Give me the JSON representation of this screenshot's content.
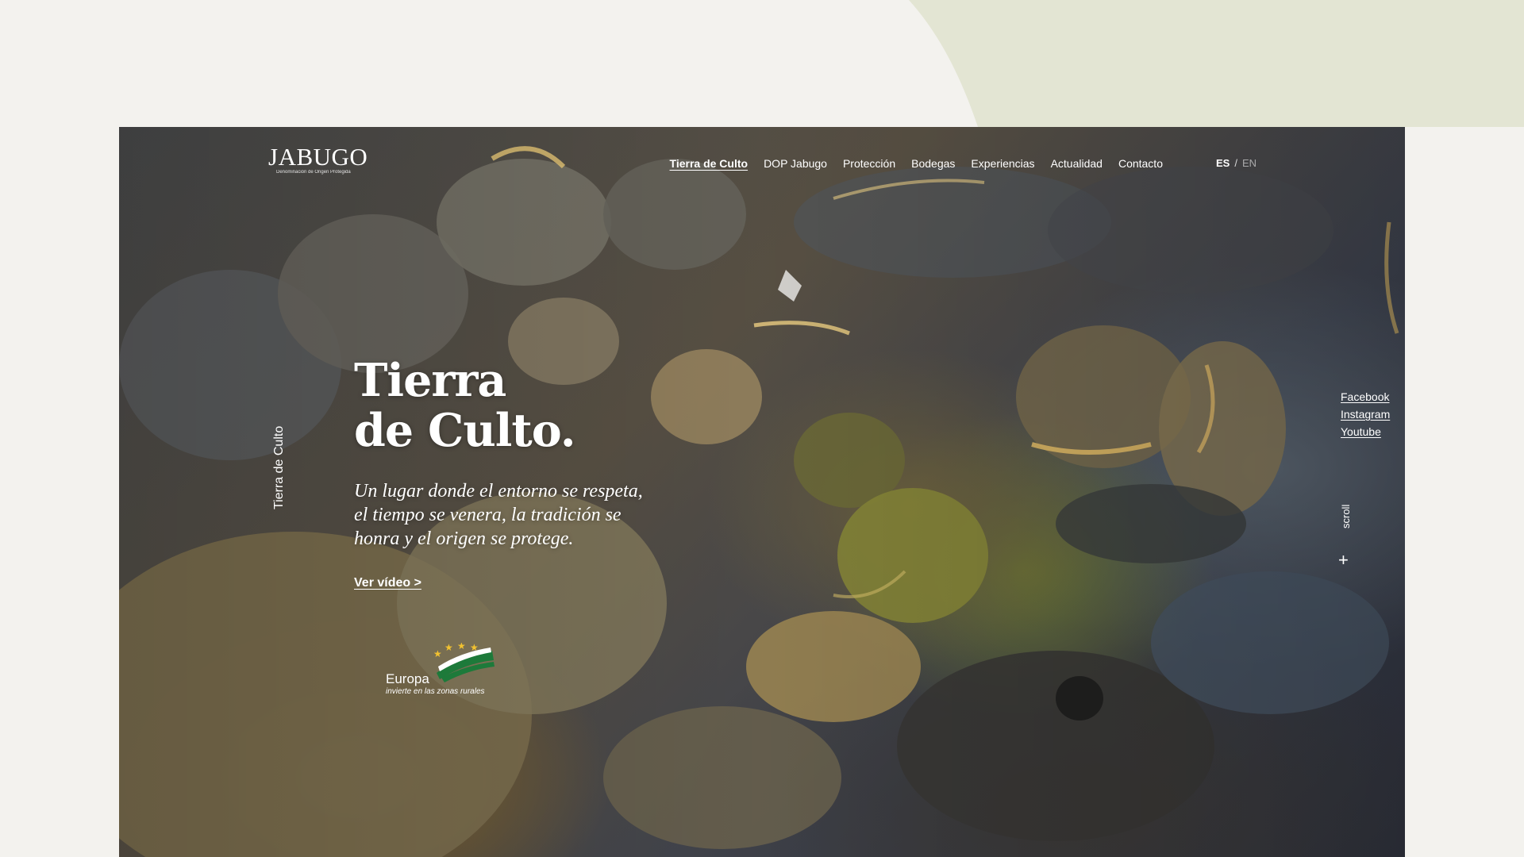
{
  "brand": {
    "name": "JABUGO",
    "subtitle": "Denominación de Origen Protegida"
  },
  "nav": {
    "items": [
      {
        "label": "Tierra de Culto",
        "active": true
      },
      {
        "label": "DOP Jabugo",
        "active": false
      },
      {
        "label": "Protección",
        "active": false
      },
      {
        "label": "Bodegas",
        "active": false
      },
      {
        "label": "Experiencias",
        "active": false
      },
      {
        "label": "Actualidad",
        "active": false
      },
      {
        "label": "Contacto",
        "active": false
      }
    ]
  },
  "lang": {
    "current": "ES",
    "separator": "/",
    "other": "EN"
  },
  "hero": {
    "side_label": "Tierra de Culto",
    "title_line1": "Tierra",
    "title_line2": "de Culto.",
    "subtitle_line1": "Un lugar donde el entorno se respeta,",
    "subtitle_line2": "el tiempo se venera, la tradición se",
    "subtitle_line3": "honra y el origen se protege.",
    "video_link": "Ver vídeo >",
    "background": "river-stones-video"
  },
  "eu": {
    "name": "Europa",
    "tagline": "invierte en las zonas rurales"
  },
  "social": {
    "items": [
      "Facebook",
      "Instagram",
      "Youtube"
    ]
  },
  "scroll": {
    "label": "scroll",
    "icon": "+"
  },
  "colors": {
    "page_background": "#f3f2ee",
    "accent_shape": "#e3e5d3",
    "text_on_hero": "#ffffff"
  }
}
